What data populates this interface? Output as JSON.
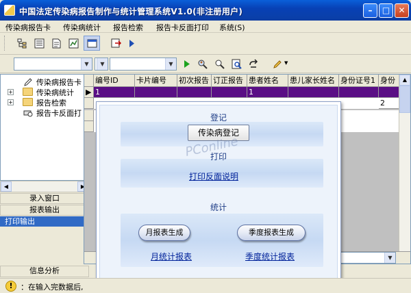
{
  "window": {
    "title": "中国法定传染病报告制作与统计管理系统V1.0(非注册用户)"
  },
  "menu": [
    "传染病报告卡",
    "传染病统计",
    "报告检索",
    "报告卡反面打印",
    "系统(S)"
  ],
  "tree": [
    {
      "label": "传染病报告卡",
      "icon": "pen-icon",
      "expandable": false
    },
    {
      "label": "传染病统计",
      "icon": "folder-icon",
      "expandable": true
    },
    {
      "label": "报告检索",
      "icon": "folder-icon",
      "expandable": true
    },
    {
      "label": "报告卡反面打",
      "icon": "printer-search-icon",
      "expandable": false
    }
  ],
  "nav": {
    "entry": "录入窗口",
    "report_output": "报表输出",
    "print_output": "打印输出",
    "analysis": "信息分析"
  },
  "grid": {
    "columns": [
      "编号ID",
      "卡片编号",
      "初次报告",
      "订正报告",
      "患者姓名",
      "患儿家长姓名",
      "身份证号1",
      "身份"
    ],
    "rows": [
      {
        "id": "1",
        "patient": "1",
        "idno": ""
      },
      {
        "id": "",
        "patient": "",
        "idno": "2"
      }
    ]
  },
  "dialog": {
    "register_title": "登记",
    "register_button": "传染病登记",
    "print_title": "打印",
    "print_link": "打印反面说明",
    "stats_title": "统计",
    "monthly_button": "月报表生成",
    "quarterly_button": "季度报表生成",
    "monthly_link": "月统计报表",
    "quarterly_link": "季度统计报表",
    "watermark": "PConline"
  },
  "status": {
    "text": "：在输入完数据后,"
  },
  "colors": {
    "title_bar": "#0a4fc8",
    "selected_row": "#5a0e85",
    "nav_selected": "#316ac5",
    "link": "#00229a"
  }
}
